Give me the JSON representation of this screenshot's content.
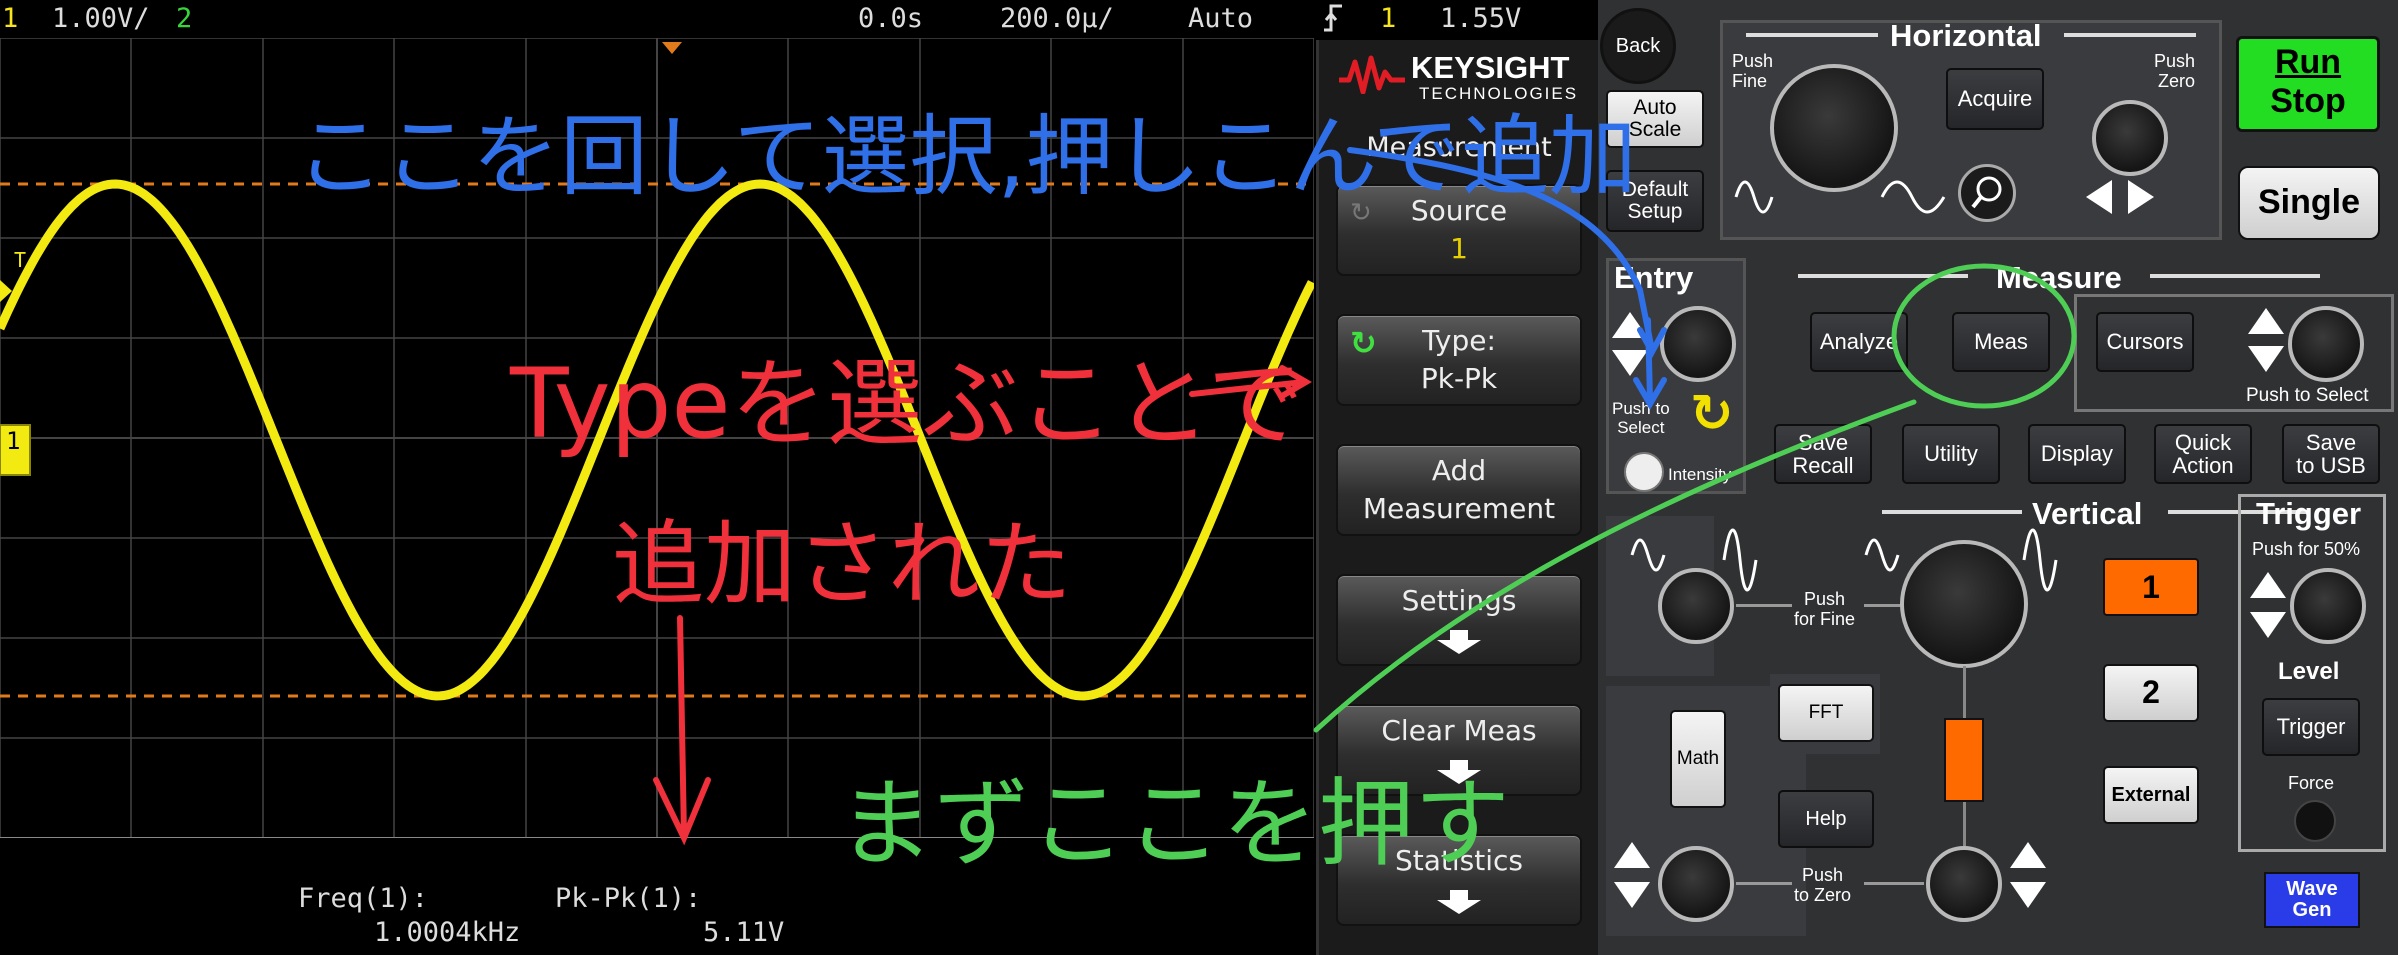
{
  "status_bar": {
    "channel1_num": "1",
    "channel1_scale": "1.00V/",
    "channel2_num": "2",
    "time_offset": "0.0s",
    "time_scale": "200.0µ/",
    "trigger_mode": "Auto",
    "trigger_slope_icon": "rising-edge-icon",
    "trigger_source": "1",
    "trigger_level": "1.55V"
  },
  "screen": {
    "trigger_marker": "T",
    "channel_marker": "1"
  },
  "measurements": {
    "m1_label": "Freq(1):",
    "m1_value": "1.0004kHz",
    "m2_label": "Pk-Pk(1):",
    "m2_value": "5.11V"
  },
  "softmenu": {
    "brand": "KEYSIGHT",
    "brand_sub": "TECHNOLOGIES",
    "title": "Measurement",
    "keys": [
      {
        "label": "Source",
        "value": "1"
      },
      {
        "label": "Type:",
        "value": "Pk-Pk"
      },
      {
        "label": "Add",
        "value": "Measurement"
      },
      {
        "label": "Settings"
      },
      {
        "label": "Clear Meas"
      },
      {
        "label": "Statistics"
      }
    ]
  },
  "annotations": {
    "blue": "ここを回して選択,押しこんで追加",
    "red1": "Typeを選ぶことで",
    "red2": "追加された",
    "green": "まずここを押す"
  },
  "panel": {
    "back": "Back",
    "horizontal": "Horizontal",
    "push_fine": "Push\nFine",
    "push_zero_h": "Push\nZero",
    "acquire": "Acquire",
    "auto_scale": "Auto\nScale",
    "default_setup": "Default\nSetup",
    "run_stop_1": "Run",
    "run_stop_2": "Stop",
    "single": "Single",
    "entry": "Entry",
    "push_to_select_entry": "Push to\nSelect",
    "intensity": "Intensity",
    "measure": "Measure",
    "analyze": "Analyze",
    "meas": "Meas",
    "cursors": "Cursors",
    "push_to_select": "Push to Select",
    "save_recall": "Save\nRecall",
    "utility": "Utility",
    "display": "Display",
    "quick_action": "Quick\nAction",
    "save_usb": "Save\nto USB",
    "vertical": "Vertical",
    "push_for_fine": "Push\nfor Fine",
    "push_to_zero": "Push\nto Zero",
    "math": "Math",
    "fft": "FFT",
    "help": "Help",
    "ch1": "1",
    "ch2": "2",
    "external": "External",
    "trigger": "Trigger",
    "push_for_50": "Push for 50%",
    "level": "Level",
    "trigger_btn": "Trigger",
    "force": "Force",
    "wave_gen": "Wave\nGen"
  },
  "colors": {
    "trace": "#f2ea10",
    "ch1": "#f5e51a",
    "ch2": "#39d33a",
    "cursor": "#e07a1c",
    "run_stop": "#22dd22",
    "ch1_button": "#ff6a00",
    "wave_gen": "#2a3be8",
    "annot_blue": "#2f6fe8",
    "annot_red": "#f0303a",
    "annot_green": "#4fce55"
  }
}
